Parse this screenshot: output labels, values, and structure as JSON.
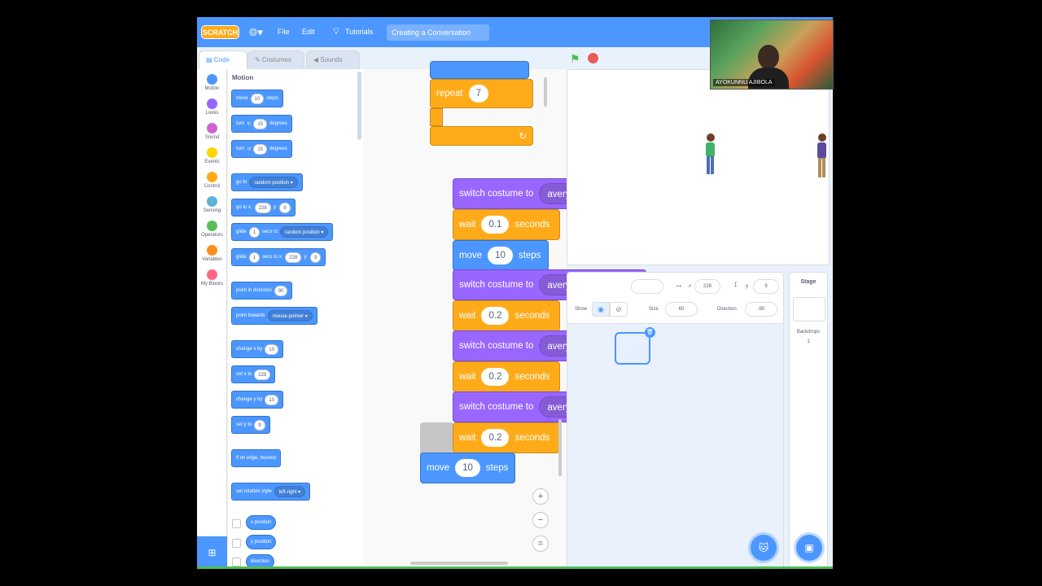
{
  "menubar": {
    "logo": "SCRATCH",
    "globe_icon": "globe-icon",
    "file": "File",
    "edit": "Edit",
    "tutorials": "Tutorials",
    "project_title": "Creating a Conversation"
  },
  "tabs": [
    {
      "label": "Code",
      "icon": "code-icon"
    },
    {
      "label": "Costumes",
      "icon": "brush-icon"
    },
    {
      "label": "Sounds",
      "icon": "speaker-icon"
    }
  ],
  "categories": [
    {
      "label": "Motion",
      "color": "#4c97ff"
    },
    {
      "label": "Looks",
      "color": "#9966ff"
    },
    {
      "label": "Sound",
      "color": "#cf63cf"
    },
    {
      "label": "Events",
      "color": "#ffd500"
    },
    {
      "label": "Control",
      "color": "#ffab19"
    },
    {
      "label": "Sensing",
      "color": "#5cb1d6"
    },
    {
      "label": "Operators",
      "color": "#59c059"
    },
    {
      "label": "Variables",
      "color": "#ff8c1a"
    },
    {
      "label": "My Blocks",
      "color": "#ff6680"
    }
  ],
  "palette": {
    "heading": "Motion",
    "move": {
      "a": "move",
      "v": "10",
      "b": "steps"
    },
    "turn_right": {
      "a": "turn",
      "v": "15",
      "b": "degrees"
    },
    "turn_left": {
      "a": "turn",
      "v": "15",
      "b": "degrees"
    },
    "goto": {
      "a": "go to",
      "dd": "random position"
    },
    "gotoxy": {
      "a": "go to x:",
      "x": "228",
      "b": "y:",
      "y": "9"
    },
    "glide1": {
      "a": "glide",
      "v": "1",
      "b": "secs to",
      "dd": "random position"
    },
    "glide2": {
      "a": "glide",
      "v": "1",
      "b": "secs to x:",
      "x": "228",
      "c": "y:",
      "y": "9"
    },
    "point_dir": {
      "a": "point in direction",
      "v": "90"
    },
    "point_towards": {
      "a": "point towards",
      "dd": "mouse-pointer"
    },
    "change_x": {
      "a": "change x by",
      "v": "10"
    },
    "set_x": {
      "a": "set x to",
      "v": "228"
    },
    "change_y": {
      "a": "change y by",
      "v": "10"
    },
    "set_y": {
      "a": "set y to",
      "v": "9"
    },
    "bounce": "if on edge, bounce",
    "rotation": {
      "a": "set rotation style",
      "dd": "left-right"
    },
    "xpos": "x position",
    "ypos": "y position",
    "direction": "direction"
  },
  "script": {
    "repeat": {
      "label": "repeat",
      "value": "7"
    },
    "b1": {
      "label": "switch costume to",
      "dd": "avery walking-a"
    },
    "b2": {
      "a": "wait",
      "v": "0.1",
      "b": "seconds"
    },
    "b3": {
      "a": "move",
      "v": "10",
      "b": "steps"
    },
    "b4": {
      "label": "switch costume to",
      "dd": "avery walking-b"
    },
    "b5": {
      "a": "wait",
      "v": "0.2",
      "b": "seconds"
    },
    "b6": {
      "label": "switch costume to",
      "dd": "avery walking-c"
    },
    "b7": {
      "a": "wait",
      "v": "0.2",
      "b": "seconds"
    },
    "b8": {
      "label": "switch costume to",
      "dd": "avery walking-d"
    },
    "b9": {
      "a": "wait",
      "v": "0.2",
      "b": "seconds"
    },
    "b10": {
      "a": "move",
      "v": "10",
      "b": "steps"
    }
  },
  "sprite_info": {
    "x_label": "x",
    "x": "228",
    "y_label": "y",
    "y": "9",
    "show": "Show",
    "size_label": "Size",
    "size": "60",
    "direction_label": "Direction",
    "direction": "-90"
  },
  "stage_panel": {
    "title": "Stage",
    "backdrops_label": "Backdrops",
    "backdrops_count": "1"
  },
  "webcam": {
    "name": "AYOKUNNU AJIBOLA"
  }
}
